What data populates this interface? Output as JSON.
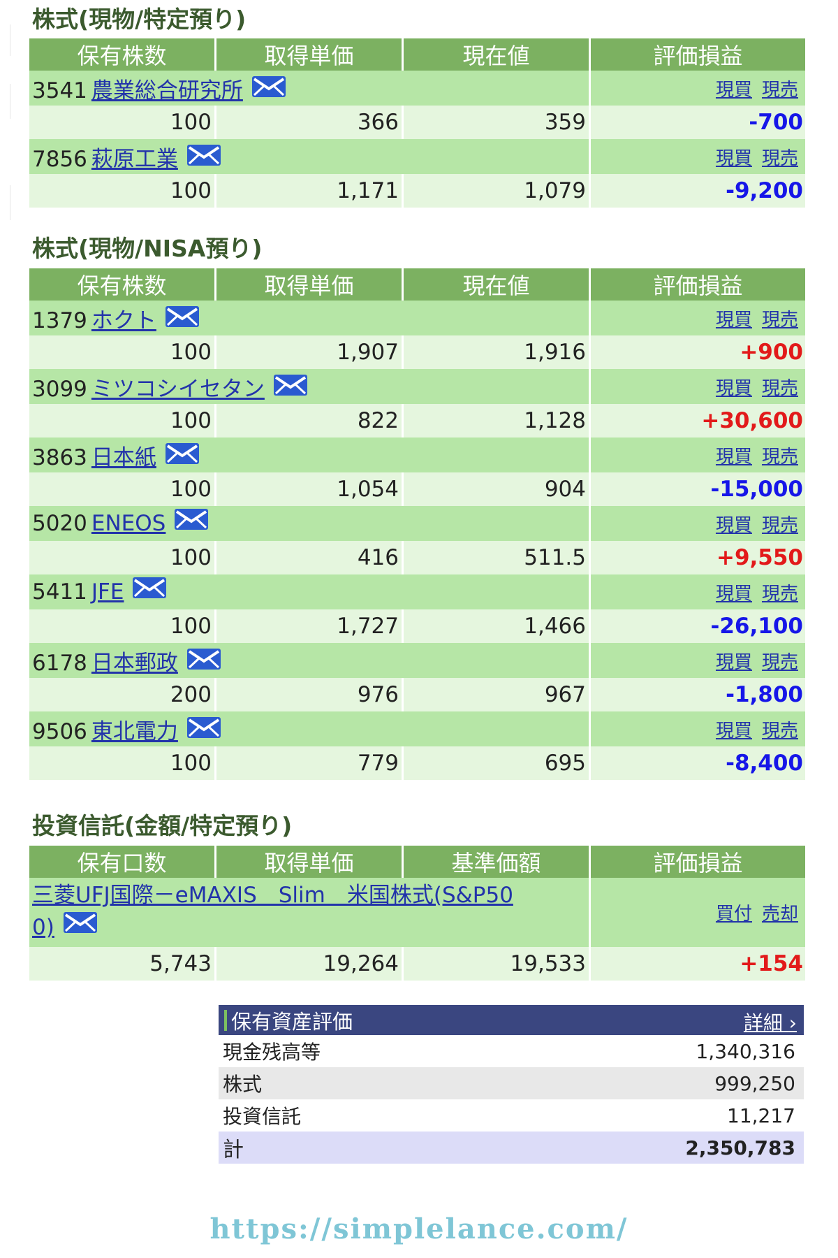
{
  "sections": [
    {
      "title": "株式(現物/特定預り)",
      "headers": [
        "保有株数",
        "取得単価",
        "現在値",
        "評価損益"
      ],
      "rows": [
        {
          "code": "3541",
          "name": "農業総合研究所",
          "qty": "100",
          "cost": "366",
          "price": "359",
          "pl": "-700",
          "sign": "neg"
        },
        {
          "code": "7856",
          "name": "萩原工業",
          "qty": "100",
          "cost": "1,171",
          "price": "1,079",
          "pl": "-9,200",
          "sign": "neg"
        }
      ]
    },
    {
      "title": "株式(現物/NISA預り)",
      "headers": [
        "保有株数",
        "取得単価",
        "現在値",
        "評価損益"
      ],
      "rows": [
        {
          "code": "1379",
          "name": "ホクト",
          "qty": "100",
          "cost": "1,907",
          "price": "1,916",
          "pl": "+900",
          "sign": "pos"
        },
        {
          "code": "3099",
          "name": "ミツコシイセタン",
          "qty": "100",
          "cost": "822",
          "price": "1,128",
          "pl": "+30,600",
          "sign": "pos"
        },
        {
          "code": "3863",
          "name": "日本紙",
          "qty": "100",
          "cost": "1,054",
          "price": "904",
          "pl": "-15,000",
          "sign": "neg"
        },
        {
          "code": "5020",
          "name": "ENEOS",
          "qty": "100",
          "cost": "416",
          "price": "511.5",
          "pl": "+9,550",
          "sign": "pos"
        },
        {
          "code": "5411",
          "name": "JFE",
          "qty": "100",
          "cost": "1,727",
          "price": "1,466",
          "pl": "-26,100",
          "sign": "neg"
        },
        {
          "code": "6178",
          "name": "日本郵政",
          "qty": "200",
          "cost": "976",
          "price": "967",
          "pl": "-1,800",
          "sign": "neg"
        },
        {
          "code": "9506",
          "name": "東北電力",
          "qty": "100",
          "cost": "779",
          "price": "695",
          "pl": "-8,400",
          "sign": "neg"
        }
      ]
    }
  ],
  "stock_actions": {
    "buy": "現買",
    "sell": "現売"
  },
  "fund_section": {
    "title": "投資信託(金額/特定預り)",
    "headers": [
      "保有口数",
      "取得単価",
      "基準価額",
      "評価損益"
    ],
    "name_line1": "三菱UFJ国際－eMAXIS　Slim　米国株式(S&P50",
    "name_line2": "0)",
    "actions": {
      "buy": "買付",
      "sell": "売却"
    },
    "qty": "5,743",
    "cost": "19,264",
    "price": "19,533",
    "pl": "+154"
  },
  "summary": {
    "title": "保有資産評価",
    "detail_link": "詳細",
    "rows": [
      {
        "label": "現金残高等",
        "value": "1,340,316"
      },
      {
        "label": "株式",
        "value": "999,250"
      },
      {
        "label": "投資信託",
        "value": "11,217"
      }
    ],
    "total_label": "計",
    "total_value": "2,350,783"
  },
  "footer_url": "https://simplelance.com/",
  "colors": {
    "header_green": "#7cb161",
    "name_row_green": "#b6e6a6",
    "value_row_green": "#e5f6de",
    "negative_blue": "#1616e8",
    "positive_red": "#e21a1a",
    "summary_header_navy": "#3a4680"
  }
}
